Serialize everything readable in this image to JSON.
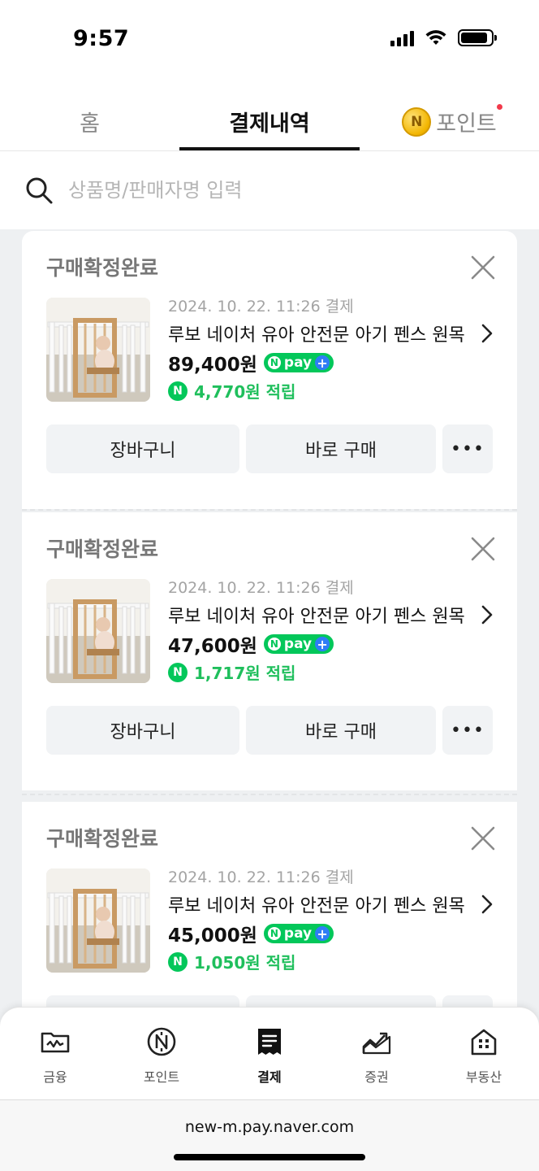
{
  "status_bar": {
    "time": "9:57"
  },
  "tabs": {
    "home": "홈",
    "history": "결제내역",
    "point": "포인트",
    "point_coin_glyph": "N"
  },
  "search": {
    "placeholder": "상품명/판매자명 입력"
  },
  "orders": [
    {
      "status": "구매확정완료",
      "date": "2024. 10. 22. 11:26 결제",
      "name": "루보 네이처 유아 안전문 아기 펜스 원목",
      "price": "89,400원",
      "reward": "4,770원 적립"
    },
    {
      "status": "구매확정완료",
      "date": "2024. 10. 22. 11:26 결제",
      "name": "루보 네이처 유아 안전문 아기 펜스 원목",
      "price": "47,600원",
      "reward": "1,717원 적립"
    },
    {
      "status": "구매확정완료",
      "date": "2024. 10. 22. 11:26 결제",
      "name": "루보 네이처 유아 안전문 아기 펜스 원목",
      "price": "45,000원",
      "reward": "1,050원 적립"
    }
  ],
  "order_actions": {
    "cart": "장바구니",
    "buy_now": "바로 구매",
    "more": "•••"
  },
  "npay_badge": {
    "n": "N",
    "text": "pay",
    "plus": "+"
  },
  "bottom_nav": [
    {
      "label": "금융",
      "icon": "finance-folder-icon"
    },
    {
      "label": "포인트",
      "icon": "npoint-coin-icon"
    },
    {
      "label": "결제",
      "icon": "receipt-icon",
      "active": true
    },
    {
      "label": "증권",
      "icon": "stock-chart-icon"
    },
    {
      "label": "부동산",
      "icon": "house-icon"
    }
  ],
  "browser": {
    "url": "new-m.pay.naver.com"
  },
  "colors": {
    "accent_green": "#03c75a",
    "reward_green": "#1fbf5c",
    "notification_red": "#f2394b",
    "plus_blue": "#2f7df6"
  }
}
